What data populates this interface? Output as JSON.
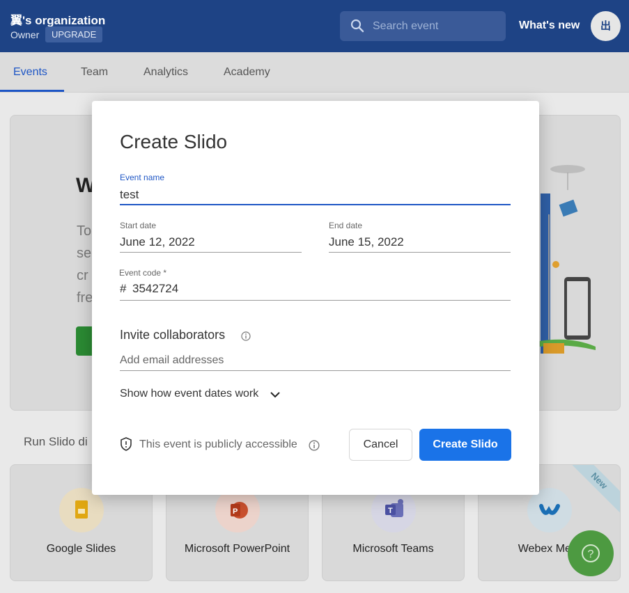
{
  "header": {
    "org_name": "翼's organization",
    "role": "Owner",
    "upgrade_label": "UPGRADE",
    "search_placeholder": "Search event",
    "whats_new": "What's new",
    "avatar_initial": "出"
  },
  "tabs": [
    {
      "label": "Events",
      "active": true
    },
    {
      "label": "Team"
    },
    {
      "label": "Analytics"
    },
    {
      "label": "Academy"
    }
  ],
  "background": {
    "welcome_initial": "W",
    "lines": [
      "To",
      "se",
      "cr",
      "fre"
    ],
    "run_label": "Run Slido di",
    "integrations": [
      {
        "label": "Google Slides",
        "icon": "google-slides-icon"
      },
      {
        "label": "Microsoft PowerPoint",
        "icon": "powerpoint-icon"
      },
      {
        "label": "Microsoft Teams",
        "icon": "teams-icon"
      },
      {
        "label": "Webex Meet",
        "icon": "webex-icon",
        "badge": "New"
      }
    ],
    "help_icon": "?"
  },
  "modal": {
    "title": "Create Slido",
    "event_name_label": "Event name",
    "event_name_value": "test",
    "start_date_label": "Start date",
    "start_date_value": "June 12, 2022",
    "end_date_label": "End date",
    "end_date_value": "June 15, 2022",
    "event_code_label": "Event code *",
    "event_code_prefix": "#",
    "event_code_value": "3542724",
    "invite_title": "Invite collaborators",
    "invite_placeholder": "Add email addresses",
    "show_dates_label": "Show how event dates work",
    "public_note": "This event is publicly accessible",
    "cancel_label": "Cancel",
    "create_label": "Create Slido"
  },
  "colors": {
    "header_bg": "#1e4385",
    "accent": "#1a73e8",
    "help_button": "#4d9a41"
  }
}
